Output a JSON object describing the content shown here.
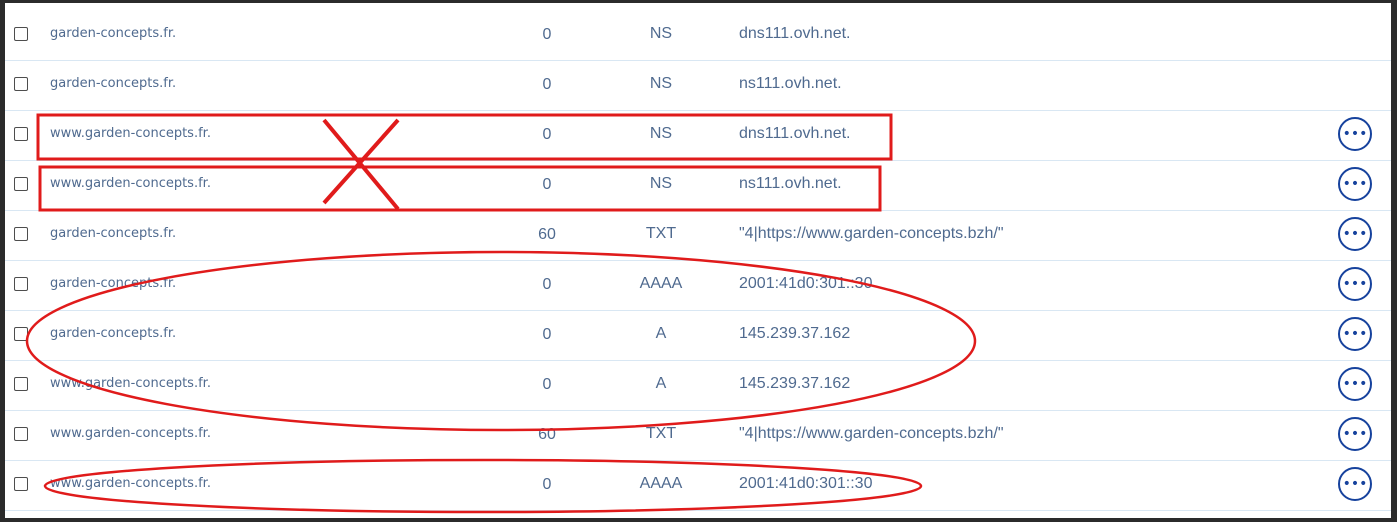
{
  "records": [
    {
      "domain": "garden-concepts.fr.",
      "ttl": "0",
      "type": "NS",
      "target": "dns111.ovh.net.",
      "actions": false
    },
    {
      "domain": "garden-concepts.fr.",
      "ttl": "0",
      "type": "NS",
      "target": "ns111.ovh.net.",
      "actions": false
    },
    {
      "domain": "www.garden-concepts.fr.",
      "ttl": "0",
      "type": "NS",
      "target": "dns111.ovh.net.",
      "actions": true
    },
    {
      "domain": "www.garden-concepts.fr.",
      "ttl": "0",
      "type": "NS",
      "target": "ns111.ovh.net.",
      "actions": true
    },
    {
      "domain": "garden-concepts.fr.",
      "ttl": "60",
      "type": "TXT",
      "target": "\"4|https://www.garden-concepts.bzh/\"",
      "actions": true
    },
    {
      "domain": "garden-concepts.fr.",
      "ttl": "0",
      "type": "AAAA",
      "target": "2001:41d0:301::30",
      "actions": true
    },
    {
      "domain": "garden-concepts.fr.",
      "ttl": "0",
      "type": "A",
      "target": "145.239.37.162",
      "actions": true
    },
    {
      "domain": "www.garden-concepts.fr.",
      "ttl": "0",
      "type": "A",
      "target": "145.239.37.162",
      "actions": true
    },
    {
      "domain": "www.garden-concepts.fr.",
      "ttl": "60",
      "type": "TXT",
      "target": "\"4|https://www.garden-concepts.bzh/\"",
      "actions": true
    },
    {
      "domain": "www.garden-concepts.fr.",
      "ttl": "0",
      "type": "AAAA",
      "target": "2001:41d0:301::30",
      "actions": true
    }
  ],
  "actions_icon": "more-horizontal-icon",
  "colors": {
    "text": "#4f6a8f",
    "action": "#16429d",
    "annotation": "#e01b1b",
    "row_border": "#d9e7f3"
  }
}
